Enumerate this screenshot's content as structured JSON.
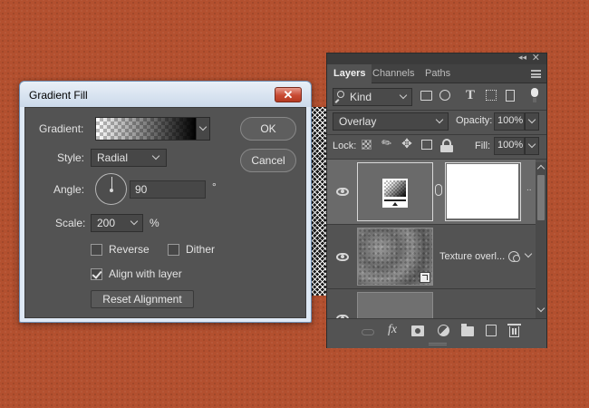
{
  "gradient_fill": {
    "title": "Gradient Fill",
    "close_glyph": "✕",
    "gradient_label": "Gradient:",
    "style_label": "Style:",
    "style_value": "Radial",
    "angle_label": "Angle:",
    "angle_value": "90",
    "angle_unit": "°",
    "scale_label": "Scale:",
    "scale_value": "200",
    "scale_unit": "%",
    "reverse_label": "Reverse",
    "reverse_checked": false,
    "dither_label": "Dither",
    "dither_checked": false,
    "align_label": "Align with layer",
    "align_checked": true,
    "reset_label": "Reset Alignment",
    "ok_label": "OK",
    "cancel_label": "Cancel"
  },
  "layers_panel": {
    "tabs": [
      {
        "label": "Layers",
        "active": true
      },
      {
        "label": "Channels",
        "active": false
      },
      {
        "label": "Paths",
        "active": false
      }
    ],
    "filter_kind": "Kind",
    "blend_mode": "Overlay",
    "opacity_label": "Opacity:",
    "opacity_value": "100%",
    "lock_label": "Lock:",
    "fill_label": "Fill:",
    "fill_value": "100%",
    "layers": [
      {
        "name": "",
        "type": "gradient-fill",
        "selected": true,
        "visible": true
      },
      {
        "name": "Texture overl...",
        "type": "smart-object",
        "selected": false,
        "visible": true
      },
      {
        "name": "",
        "type": "layer",
        "selected": false,
        "visible": true
      }
    ],
    "bottom_icons": [
      "link-icon",
      "fx-icon",
      "mask-icon",
      "adjustment-icon",
      "folder-icon",
      "new-layer-icon",
      "trash-icon"
    ],
    "fx_label": "fx"
  }
}
